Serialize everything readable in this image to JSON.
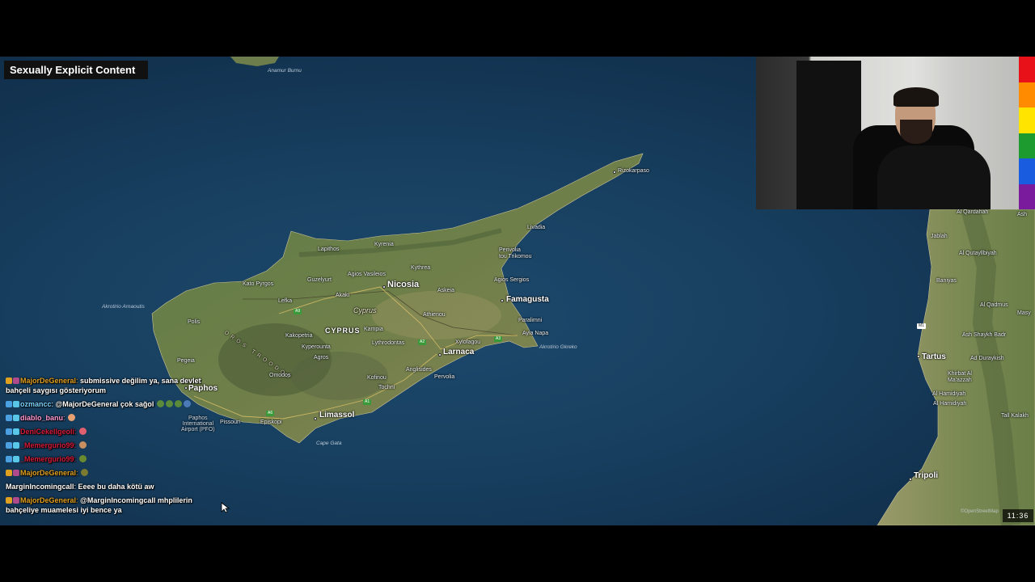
{
  "overlay": {
    "content_warning": "Sexually Explicit Content",
    "time": "11:36",
    "attribution": "©OpenStreetMap"
  },
  "colors": {
    "rainbow": [
      "#e8111a",
      "#ff8c00",
      "#ffe400",
      "#1e9b2e",
      "#1a5ce0",
      "#7a1a9c"
    ],
    "sea": "#173e5e",
    "land": "#5f7a44"
  },
  "map": {
    "labels": {
      "anamur": "Anamur Burnu",
      "rizokarpaso": "Rizokarpaso",
      "livadia": "Livadia",
      "kyrenia": "Kyrenia",
      "lapithos": "Lapithos",
      "kythrea": "Kythrea",
      "perivolia": "Perivolia\ntou Trikomou",
      "kato_pyrgos": "Kato Pyrgos",
      "guzelyurt": "Guzelyurt",
      "agios_vasileios": "Agios Vasileios",
      "nicosia": "Nicosia",
      "agios_sergios": "Agios Sergios",
      "akrotirio_arnaoutis": "Akrotirio Arnaoutis",
      "lefka": "Lefka",
      "akaki": "Akaki",
      "askeia": "Askeia",
      "cyprus_region": "Cyprus",
      "famagusta": "Famagusta",
      "polis": "Polis",
      "athienou": "Athienou",
      "paralimni": "Paralimni",
      "cyprus_country": "CYPRUS",
      "kakopetria": "Kakopetria",
      "kampia": "Kampia",
      "ayia_napa": "Ayia Napa",
      "kyperounta": "Kyperounta",
      "lythrodontas": "Lythrodontas",
      "xylofagou": "Xylofagou",
      "akrotirio_gkreko": "Akrotirio Gkreko",
      "pegeia": "Pegeia",
      "agros": "Agros",
      "larnaca": "Larnaca",
      "troodos_range": "OROS TROODOS",
      "omodos": "Omodos",
      "anglisides": "Anglisides",
      "kofinou": "Kofinou",
      "pervolia": "Pervolia",
      "paphos": "Paphos",
      "tochni": "Tochni",
      "paphos_airport": "Paphos\nInternational\nAirport (PFO)",
      "limassol": "Limassol",
      "pissouri": "Pissouri",
      "episkopi": "Episkopi",
      "cape_gata": "Cape Gata",
      "al_qardahah": "Al Qardahah",
      "jablah": "Jablah",
      "al_qutayllbiyah": "Al Qutayllbiyah",
      "baniyas": "Baniyas",
      "al_qadmus": "Al Qadmus",
      "masyaf": "Masy",
      "ash_shaykh_badr": "Ash Shaykh Badr",
      "tartus": "Tartus",
      "ad_duraykish": "Ad Duraykish",
      "khirbat": "Khirbat Al\nMa'azzah",
      "al_hamidiyah": "Al Hamidiyah",
      "al_hamidiyah_ar": "Al Hamidiyah",
      "tall_kalakh": "Tall Kalakh",
      "tripoli": "Tripoli",
      "ash": "Ash"
    },
    "roads": {
      "a9": "A9",
      "a2": "A2",
      "a3": "A3",
      "a1": "A1",
      "a6": "A6",
      "m1": "M1"
    }
  },
  "chat": {
    "messages": [
      {
        "user": "MajorDeGeneral",
        "sep": ": ",
        "text": "submissive değilim ya, sana devlet bahçeli saygısı gösteriyorum",
        "user_color": "#e0a020"
      },
      {
        "user": "ozmancc",
        "sep": ": ",
        "text": "@MajorDeGeneral çok sağol",
        "user_color": "#7fd4ff"
      },
      {
        "user": "diablo_banu",
        "sep": ": ",
        "text": "",
        "user_color": "#ff9ad6"
      },
      {
        "user": "DeniCekellgeoli",
        "sep": ": ",
        "text": "",
        "user_color": "#d81b3a"
      },
      {
        "user": "_Memergurio99",
        "sep": ": ",
        "text": "",
        "user_color": "#d81b3a"
      },
      {
        "user": "_Memergurio99",
        "sep": ": ",
        "text": "",
        "user_color": "#d81b3a"
      },
      {
        "user": "MajorDeGeneral",
        "sep": ": ",
        "text": "",
        "user_color": "#e0a020"
      },
      {
        "user": "MarginIncomingcall",
        "sep": ": ",
        "text": "Eeee bu daha kötü aw",
        "user_color": "#ffffff"
      },
      {
        "user": "MajorDeGeneral",
        "sep": ": ",
        "text": "@MarginIncomingcall mhplilerin bahçeliye muamelesi iyi bence ya",
        "user_color": "#e0a020"
      }
    ]
  }
}
